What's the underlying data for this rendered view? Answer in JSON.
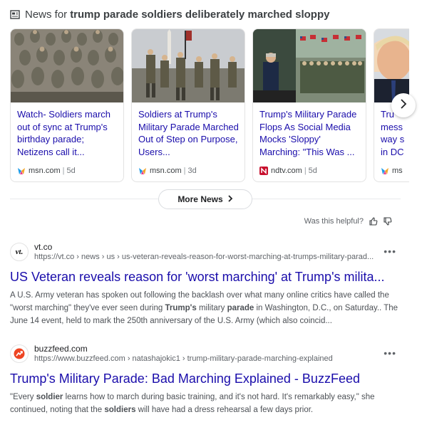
{
  "header": {
    "prefix": "News for",
    "query": "trump parade soldiers deliberately marched sloppy"
  },
  "cards": [
    {
      "headline": "Watch- Soldiers march out of sync at Trump's birthday parade; Netizens call it...",
      "source": "msn.com",
      "age": "5d",
      "source_icon": "msn-butterfly-icon"
    },
    {
      "headline": "Soldiers at Trump's Military Parade Marched Out of Step on Purpose, Users...",
      "source": "msn.com",
      "age": "3d",
      "source_icon": "msn-butterfly-icon"
    },
    {
      "headline": "Trump's Military Parade Flops As Social Media Mocks 'Sloppy' Marching: \"This Was ...",
      "source": "ndtv.com",
      "age": "5d",
      "source_icon": "ndtv-icon"
    },
    {
      "headline": "Tru mess way s in DC",
      "source": "ms",
      "age": "",
      "source_icon": "msn-butterfly-icon"
    }
  ],
  "more_news": {
    "label": "More News"
  },
  "feedback": {
    "label": "Was this helpful?"
  },
  "results": [
    {
      "site": "vt.co",
      "favicon_text": "vt.",
      "url": "https://vt.co › news › us › us-veteran-reveals-reason-for-worst-marching-at-trumps-military-parad...",
      "title": "US Veteran reveals reason for 'worst marching' at Trump's milita...",
      "snippet_html": "A U.S. Army veteran has spoken out following the backlash over what many online critics have called the \"worst marching\" they've ever seen during <b>Trump's</b> military <b>parade</b> in Washington, D.C., on Saturday.. The June 14 event, held to mark the 250th anniversary of the U.S. Army (which also coincid..."
    },
    {
      "site": "buzzfeed.com",
      "favicon_text": "",
      "url": "https://www.buzzfeed.com › natashajokic1 › trump-military-parade-marching-explained",
      "title": "Trump's Military Parade: Bad Marching Explained - BuzzFeed",
      "snippet_html": "\"Every <b>soldier</b> learns how to march during basic training, and it's not hard. It's remarkably easy,\" she continued, noting that the <b>soldiers</b> will have had a dress rehearsal a few days prior."
    }
  ],
  "colors": {
    "link": "#1a0dab",
    "buzzfeed": "#e32"
  }
}
